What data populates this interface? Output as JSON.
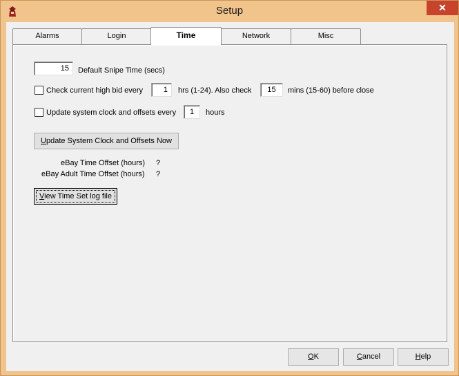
{
  "window": {
    "title": "Setup",
    "close_glyph": "✕",
    "app_icon": "spy-icon"
  },
  "tabs": [
    {
      "label": "Alarms",
      "active": false
    },
    {
      "label": "Login",
      "active": false
    },
    {
      "label": "Time",
      "active": true
    },
    {
      "label": "Network",
      "active": false
    },
    {
      "label": "Misc",
      "active": false
    }
  ],
  "time": {
    "snipe_value": "15",
    "snipe_label": "Default Snipe Time (secs)",
    "check_bid": {
      "checked": false,
      "label_before": "Check current high bid every",
      "hours_value": "1",
      "label_middle": "hrs (1-24).  Also check",
      "mins_value": "15",
      "label_after": "mins (15-60) before close"
    },
    "update_clock": {
      "checked": false,
      "label_before": "Update system clock and offsets every",
      "hours_value": "1",
      "label_after": "hours"
    },
    "update_now_button": {
      "mnemonic": "U",
      "rest": "pdate System Clock and Offsets Now"
    },
    "ebay_offset_label": "eBay Time Offset (hours)",
    "ebay_offset_value": "?",
    "ebay_adult_offset_label": "eBay Adult Time Offset (hours)",
    "ebay_adult_offset_value": "?",
    "view_log_button": {
      "mnemonic": "V",
      "rest": "iew Time Set log file"
    }
  },
  "dialog_buttons": {
    "ok": {
      "mnemonic": "O",
      "rest": "K"
    },
    "cancel": {
      "mnemonic": "C",
      "rest": "ancel"
    },
    "help": {
      "mnemonic": "H",
      "rest": "elp"
    }
  },
  "colors": {
    "titlebar": "#f0c48a",
    "close_button": "#c7432c",
    "client": "#f0f0f0"
  }
}
